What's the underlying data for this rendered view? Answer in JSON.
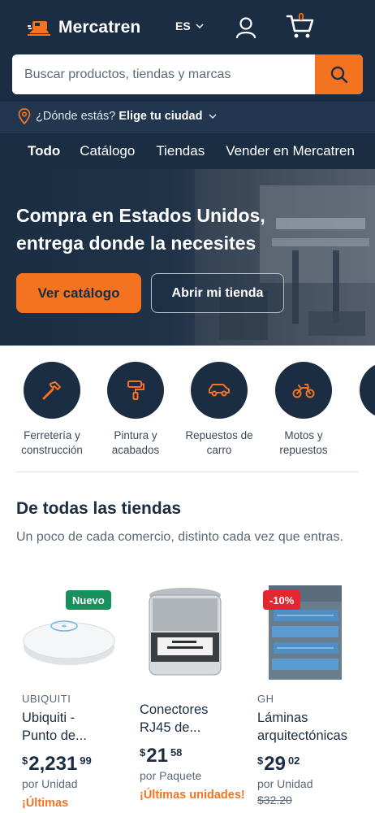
{
  "header": {
    "brand": "Mercatren",
    "language": "ES",
    "cart_count": "0",
    "colors": {
      "navy": "#1b2d42",
      "orange": "#f47321"
    }
  },
  "search": {
    "placeholder": "Buscar productos, tiendas y marcas"
  },
  "location": {
    "prompt": "¿Dónde estás?",
    "action": "Elige tu ciudad"
  },
  "nav": {
    "all": "Todo",
    "links": [
      "Catálogo",
      "Tiendas",
      "Vender en Mercatren"
    ]
  },
  "hero": {
    "title": "Compra en Estados Unidos, entrega donde la necesites",
    "primary_cta": "Ver catálogo",
    "secondary_cta": "Abrir mi tienda"
  },
  "categories": [
    {
      "label": "Ferretería y construcción",
      "icon": "hammer-icon"
    },
    {
      "label": "Pintura y acabados",
      "icon": "paint-roller-icon"
    },
    {
      "label": "Repuestos de carro",
      "icon": "car-icon"
    },
    {
      "label": "Motos y repuestos",
      "icon": "motorcycle-icon"
    },
    {
      "label": "Bi",
      "icon": "bicycle-icon"
    }
  ],
  "section": {
    "title": "De todas las tiendas",
    "subtitle": "Un poco de cada comercio, distinto cada vez que entras."
  },
  "products": [
    {
      "badge": "Nuevo",
      "brand": "UBIQUITI",
      "name_line1": "Ubiquiti -",
      "name_line2": "Punto de...",
      "currency": "$",
      "price_int": "2,231",
      "price_dec": "99",
      "unit": "por Unidad",
      "old_price": "",
      "stock": "¡Últimas"
    },
    {
      "badge": "",
      "brand": "",
      "name_line1": "Conectores",
      "name_line2": "RJ45 de...",
      "currency": "$",
      "price_int": "21",
      "price_dec": "58",
      "unit": "por Paquete",
      "old_price": "",
      "stock": "¡Últimas unidades!"
    },
    {
      "badge": "-10%",
      "brand": "GH",
      "name_line1": "Láminas",
      "name_line2": "arquitectónicas",
      "currency": "$",
      "price_int": "29",
      "price_dec": "02",
      "unit": "por Unidad",
      "old_price": "$32.20",
      "stock": ""
    }
  ]
}
